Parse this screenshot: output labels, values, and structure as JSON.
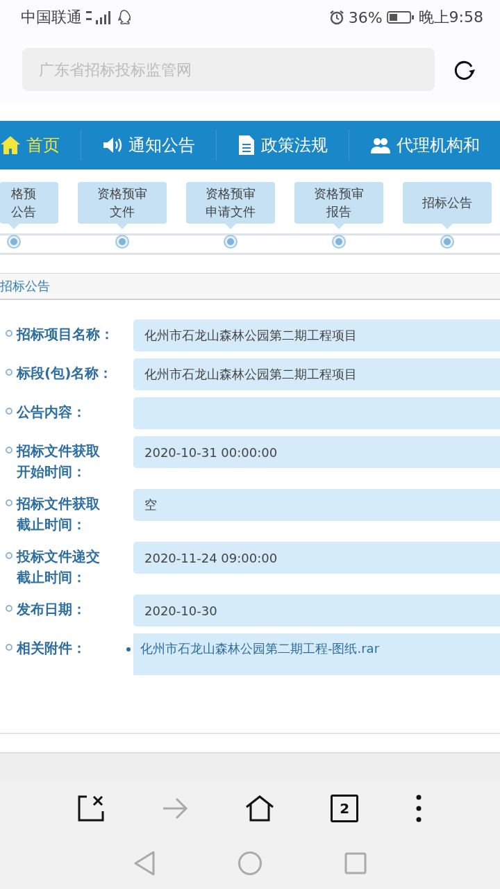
{
  "status_bar": {
    "carrier": "中国联通",
    "battery": "36%",
    "time": "晚上9:58"
  },
  "address_bar": {
    "placeholder": "广东省招标投标监管网"
  },
  "nav_tabs": [
    {
      "label": "首页",
      "selected": true
    },
    {
      "label": "通知公告",
      "selected": false
    },
    {
      "label": "政策法规",
      "selected": false
    },
    {
      "label": "代理机构和",
      "selected": false
    }
  ],
  "timeline": [
    {
      "label": "格预公告"
    },
    {
      "label": "资格预审文件"
    },
    {
      "label": "资格预审申请文件"
    },
    {
      "label": "资格预审报告"
    },
    {
      "label": "招标公告"
    }
  ],
  "section_title": "招标公告",
  "fields": [
    {
      "label": "招标项目名称：",
      "kind": "text",
      "value": "化州市石龙山森林公园第二期工程项目"
    },
    {
      "label": "标段(包)名称：",
      "kind": "text",
      "value": "化州市石龙山森林公园第二期工程项目"
    },
    {
      "label": "公告内容：",
      "kind": "text"
    },
    {
      "label": "招标文件获取开始时间：",
      "kind": "text",
      "value": "2020-10-31 00:00:00"
    },
    {
      "label": "招标文件获取截止时间：",
      "kind": "text",
      "value": "空"
    },
    {
      "label": "投标文件递交截止时间：",
      "kind": "text",
      "value": "2020-11-24 09:00:00"
    },
    {
      "label": "发布日期：",
      "kind": "text",
      "value": "2020-10-30"
    },
    {
      "label": "相关附件：",
      "kind": "attachment",
      "value": "化州市石龙山森林公园第二期工程-图纸.rar"
    }
  ],
  "browser_toolbar": {
    "tab_count": "2",
    "forward_disabled": true
  }
}
